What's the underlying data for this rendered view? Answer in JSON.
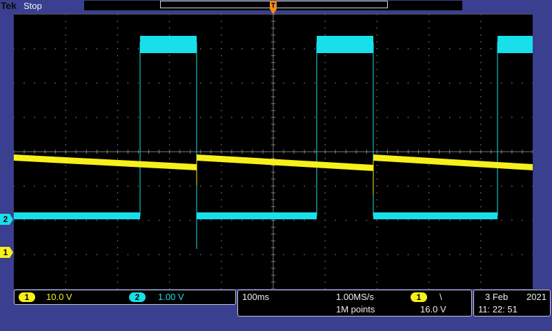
{
  "header": {
    "brand": "Tek",
    "acquisition_state": "Stop",
    "trigger_position_label": "T"
  },
  "channels": [
    {
      "id": "1",
      "color": "#f7f01a",
      "scale": "10.0 V"
    },
    {
      "id": "2",
      "color": "#18e0ea",
      "scale": "1.00 V"
    }
  ],
  "timebase": {
    "scale": "100ms",
    "sample_rate": "1.00MS/s",
    "record_length": "1M points"
  },
  "trigger": {
    "source": "1",
    "slope_symbol": "\\",
    "level": "16.0 V"
  },
  "datetime": {
    "date": "3 Feb",
    "year": "2021",
    "time": "11: 22: 51"
  },
  "colors": {
    "screen_bg": "#000000",
    "bezel": "#3a3f8f",
    "graticule": "#7a7a7a",
    "trigger_marker": "#f08a1a"
  }
}
